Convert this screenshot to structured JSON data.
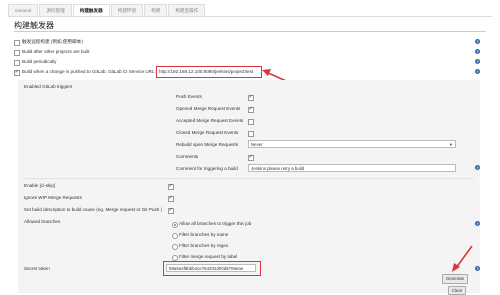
{
  "tabs": [
    "General",
    "源码管理",
    "构建触发器",
    "构建环境",
    "构建",
    "构建后操作"
  ],
  "section_title": "构建触发器",
  "triggers": [
    {
      "label": "触发远程构建 (例如,使用脚本)",
      "checked": false
    },
    {
      "label": "Build after other projects are built",
      "checked": false
    },
    {
      "label": "Build periodically",
      "checked": false
    },
    {
      "label": "Build when a change is pushed to GitLab. GitLab CI Service URL:",
      "checked": true,
      "url": "http://192.168.12.100:8080/jenkins/project/test"
    }
  ],
  "gitlab": {
    "enabled_label": "Enabled GitLab triggers",
    "events": [
      {
        "label": "Push Events",
        "checked": true
      },
      {
        "label": "Opened Merge Request Events",
        "checked": true
      },
      {
        "label": "Accepted Merge Request Events",
        "checked": false
      },
      {
        "label": "Closed Merge Request Events",
        "checked": false
      }
    ],
    "rebuild_label": "Rebuild open Merge Requests",
    "rebuild_value": "Never",
    "comments_label": "Comments",
    "comments_checked": true,
    "comment_trigger_label": "Comment for triggering a build",
    "comment_trigger_value": "Jenkins please retry a build",
    "ci_skip_label": "Enable [ci-skip]",
    "ignore_wip_label": "Ignore WIP Merge Requests",
    "set_desc_label": "Set build description to build cause (eg. Merge request or Git Push )",
    "allowed_branches_label": "Allowed branches",
    "branch_options": [
      {
        "label": "Allow all branches to trigger this job",
        "selected": true
      },
      {
        "label": "Filter branches by name",
        "selected": false
      },
      {
        "label": "Filter branches by regex",
        "selected": false
      },
      {
        "label": "Filter merge request by label",
        "selected": false
      }
    ],
    "secret_label": "Secret token",
    "secret_value": "58a6a4f8bbb4ce764202d00d6706eae",
    "generate_label": "Generate",
    "clear_label": "Clear"
  },
  "help_glyph": "?"
}
